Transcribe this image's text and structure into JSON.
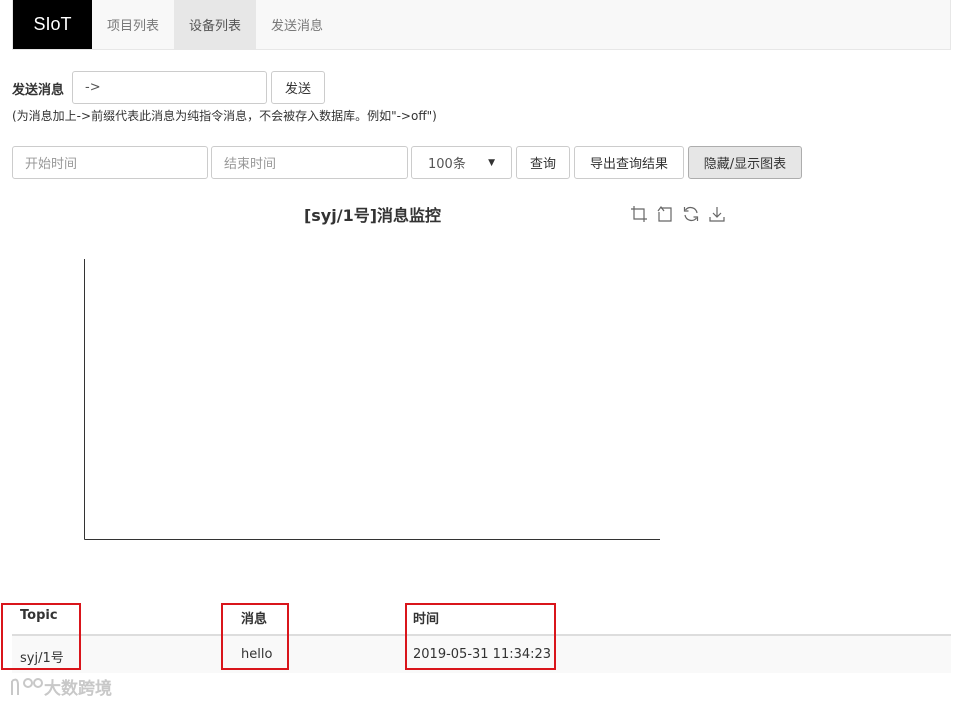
{
  "navbar": {
    "brand": "SIoT",
    "items": [
      {
        "label": "项目列表",
        "active": false
      },
      {
        "label": "设备列表",
        "active": true
      },
      {
        "label": "发送消息",
        "active": false
      }
    ]
  },
  "send": {
    "label": "发送消息",
    "input_value": "->",
    "button": "发送",
    "hint": "(为消息加上->前缀代表此消息为纯指令消息，不会被存入数据库。例如\"->off\")"
  },
  "query": {
    "start_placeholder": "开始时间",
    "end_placeholder": "结束时间",
    "limit_selected": "100条",
    "query_button": "查询",
    "export_button": "导出查询结果",
    "toggle_chart_button": "隐藏/显示图表"
  },
  "chart": {
    "title": "[syj/1号]消息监控",
    "tools": [
      "zoom-icon",
      "zoom-reset-icon",
      "restore-icon",
      "save-image-icon"
    ]
  },
  "table": {
    "headers": [
      "Topic",
      "消息",
      "时间"
    ],
    "rows": [
      [
        "syj/1号",
        "hello",
        "2019-05-31 11:34:23"
      ]
    ]
  },
  "watermark": {
    "text": "大数跨境",
    "icon": "watermark-logo-icon"
  },
  "colors": {
    "annotation_red": "#d9151b",
    "brand_bg": "#000000",
    "active_tab_bg": "#e7e7e7"
  }
}
